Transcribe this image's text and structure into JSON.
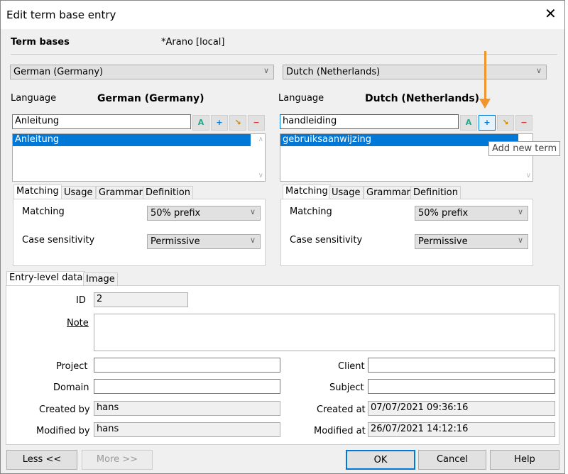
{
  "title": "Edit term base entry",
  "term_bases_label": "Term bases",
  "term_base_value": "*Arano [local]",
  "accent": "#0078d7",
  "arrow_color": "#f0962c",
  "left": {
    "lang_select": "German (Germany)",
    "language_label": "Language",
    "language": "German (Germany)",
    "term_input": "Anleitung",
    "terms": [
      "Anleitung"
    ],
    "tabs": [
      "Matching",
      "Usage",
      "Grammar",
      "Definition"
    ],
    "matching_label": "Matching",
    "matching_value": "50% prefix",
    "case_label": "Case sensitivity",
    "case_value": "Permissive"
  },
  "right": {
    "lang_select": "Dutch (Netherlands)",
    "language_label": "Language",
    "language": "Dutch (Netherlands)",
    "term_input": "handleiding",
    "terms": [
      "gebruiksaanwijzing"
    ],
    "tabs": [
      "Matching",
      "Usage",
      "Grammar",
      "Definition"
    ],
    "matching_label": "Matching",
    "matching_value": "50% prefix",
    "case_label": "Case sensitivity",
    "case_value": "Permissive"
  },
  "tooltip": "Add new term",
  "entry_tabs": [
    "Entry-level data",
    "Image"
  ],
  "fields": {
    "id_label": "ID",
    "id": "2",
    "note_label": "Note",
    "note": "",
    "project_label": "Project",
    "project": "",
    "client_label": "Client",
    "client": "",
    "domain_label": "Domain",
    "domain": "",
    "subject_label": "Subject",
    "subject": "",
    "created_by_label": "Created by",
    "created_by": "hans",
    "created_at_label": "Created at",
    "created_at": "07/07/2021 09:36:16",
    "modified_by_label": "Modified by",
    "modified_by": "hans",
    "modified_at_label": "Modified at",
    "modified_at": "26/07/2021 14:12:16"
  },
  "buttons": {
    "less": "Less <<",
    "more": "More >>",
    "ok": "OK",
    "cancel": "Cancel",
    "help": "Help"
  }
}
